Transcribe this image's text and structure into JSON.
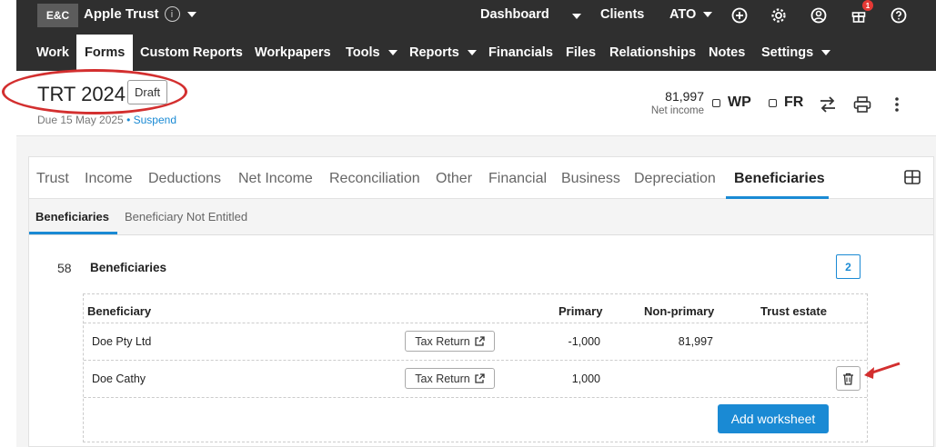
{
  "topbar": {
    "logo": "E&C",
    "entity": "Apple Trust",
    "info_glyph": "i",
    "dashboard": "Dashboard",
    "clients": "Clients",
    "ato": "ATO",
    "notifications_count": "1",
    "icons": [
      "plus-circle-icon",
      "gear-icon",
      "user-circle-icon",
      "gift-icon",
      "help-icon"
    ]
  },
  "nav": [
    "Work",
    "Forms",
    "Custom Reports",
    "Workpapers",
    "Tools",
    "Reports",
    "Financials",
    "Files",
    "Relationships",
    "Notes",
    "Settings"
  ],
  "header": {
    "title": "TRT 2024",
    "status": "Draft",
    "due": "Due 15 May 2025",
    "separator": "•",
    "suspend": "Suspend",
    "net_income_value": "81,997",
    "net_income_label": "Net income",
    "wp": "WP",
    "fr": "FR"
  },
  "tabs": [
    "Trust",
    "Income",
    "Deductions",
    "Net Income",
    "Reconciliation",
    "Other",
    "Financial",
    "Business",
    "Depreciation",
    "Beneficiaries"
  ],
  "active_tab": "Beneficiaries",
  "subtabs": [
    "Beneficiaries",
    "Beneficiary Not Entitled"
  ],
  "section": {
    "number": "58",
    "title": "Beneficiaries",
    "count": "2"
  },
  "table": {
    "headers": [
      "Beneficiary",
      "Primary",
      "Non-primary",
      "Trust estate"
    ],
    "rows": [
      {
        "name": "Doe Pty Ltd",
        "action": "Tax Return",
        "primary": "-1,000",
        "non_primary": "81,997",
        "trust_estate": ""
      },
      {
        "name": "Doe Cathy",
        "action": "Tax Return",
        "primary": "1,000",
        "non_primary": "",
        "trust_estate": ""
      }
    ],
    "add_button": "Add worksheet"
  },
  "colors": {
    "topbar": "#2f2f2f",
    "accent": "#1a8ad4",
    "annotation": "#d32f2f"
  }
}
